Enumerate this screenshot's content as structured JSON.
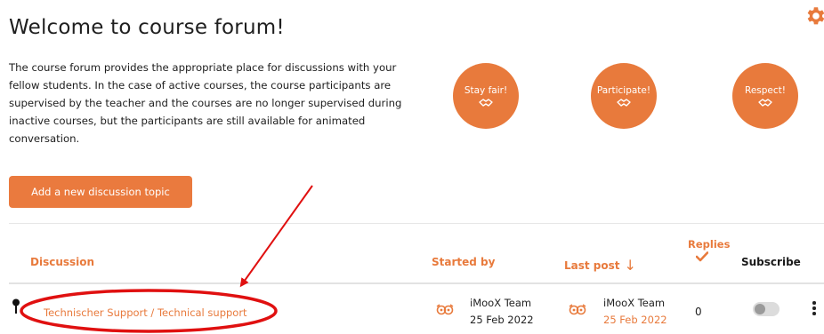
{
  "page": {
    "title": "Welcome to course forum!",
    "intro": "The course forum provides the appropriate place for discussions with your fellow students. In the case of active courses, the course participants are supervised by the teacher and the courses are no longer supervised during inactive courses, but the participants are still available for animated conversation."
  },
  "badges": [
    {
      "label": "Stay fair!",
      "icon": "handshake-icon"
    },
    {
      "label": "Participate!",
      "icon": "handshake-icon"
    },
    {
      "label": "Respect!",
      "icon": "handshake-icon"
    }
  ],
  "actions": {
    "add_topic_label": "Add a new discussion topic"
  },
  "table": {
    "headers": {
      "discussion": "Discussion",
      "started_by": "Started by",
      "last_post": "Last post",
      "replies": "Replies",
      "subscribe": "Subscribe"
    },
    "sort_icon": "arrow-down-icon",
    "rows": [
      {
        "pinned": true,
        "topic": "Technischer Support / Technical support",
        "started_by": {
          "name": "iMooX Team",
          "date": "25 Feb 2022"
        },
        "last_post": {
          "name": "iMooX Team",
          "date": "25 Feb 2022"
        },
        "replies": "0",
        "subscribed": false
      }
    ]
  },
  "colors": {
    "accent": "#e87a3c",
    "annotation": "#e01010"
  }
}
